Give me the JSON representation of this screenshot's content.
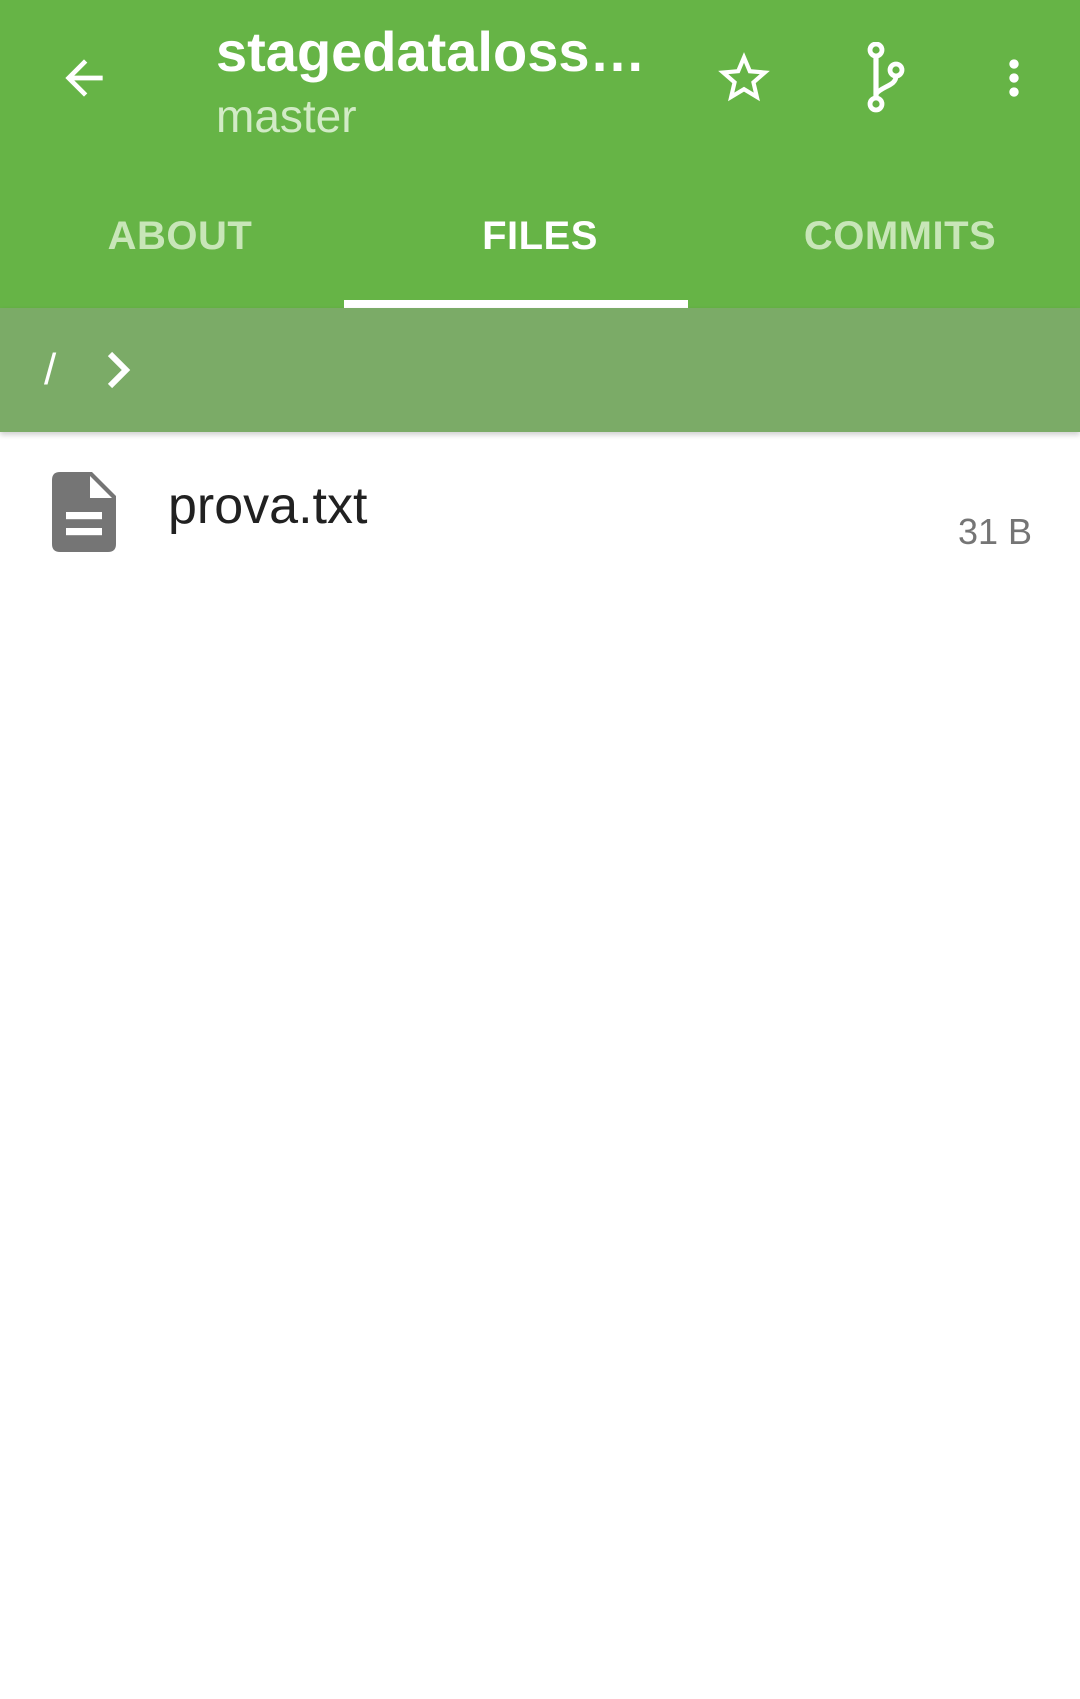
{
  "header": {
    "title": "stagedataloss…",
    "subtitle": "master",
    "back_icon": "arrow-back-icon",
    "star_icon": "star-outline-icon",
    "branch_icon": "git-branch-icon",
    "more_icon": "more-vert-icon"
  },
  "tabs": [
    {
      "label": "ABOUT",
      "active": false
    },
    {
      "label": "FILES",
      "active": true
    },
    {
      "label": "COMMITS",
      "active": false
    }
  ],
  "path": {
    "root": "/",
    "separator_icon": "chevron-right-icon"
  },
  "files": [
    {
      "name": "prova.txt",
      "size": "31 B",
      "icon": "file-document-icon"
    }
  ],
  "colors": {
    "primary": "#66b446",
    "path_bar": "#7bab67",
    "tab_inactive": "#c8e6b8",
    "subtitle": "#d2ebc6"
  }
}
